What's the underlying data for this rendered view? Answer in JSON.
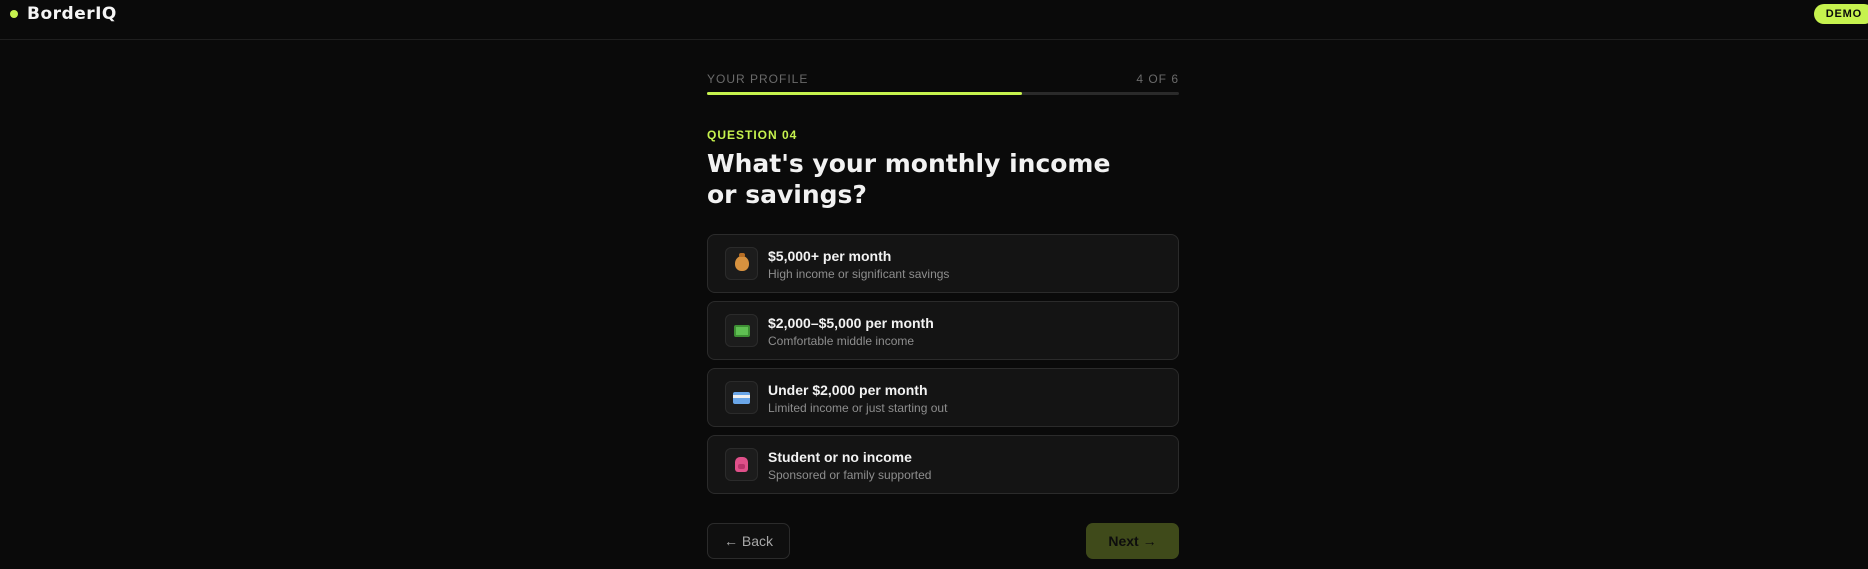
{
  "header": {
    "brand_name": "BorderIQ",
    "badge": "DEMO"
  },
  "progress": {
    "section_label": "YOUR PROFILE",
    "step_label": "4 OF 6",
    "fraction": 0.667
  },
  "question": {
    "kicker": "QUESTION 04",
    "title": "What's your monthly income or savings?"
  },
  "options": [
    {
      "icon": "money-bag-icon",
      "title": "$5,000+ per month",
      "subtitle": "High income or significant savings"
    },
    {
      "icon": "banknote-icon",
      "title": "$2,000–$5,000 per month",
      "subtitle": "Comfortable middle income"
    },
    {
      "icon": "credit-card-icon",
      "title": "Under $2,000 per month",
      "subtitle": "Limited income or just starting out"
    },
    {
      "icon": "backpack-icon",
      "title": "Student or no income",
      "subtitle": "Sponsored or family supported"
    }
  ],
  "nav": {
    "back_label": "← Back",
    "next_label": "Next →"
  },
  "colors": {
    "accent": "#c6f24e",
    "background": "#0a0a0a",
    "card": "#141414",
    "next_disabled": "#3f4a1a"
  }
}
